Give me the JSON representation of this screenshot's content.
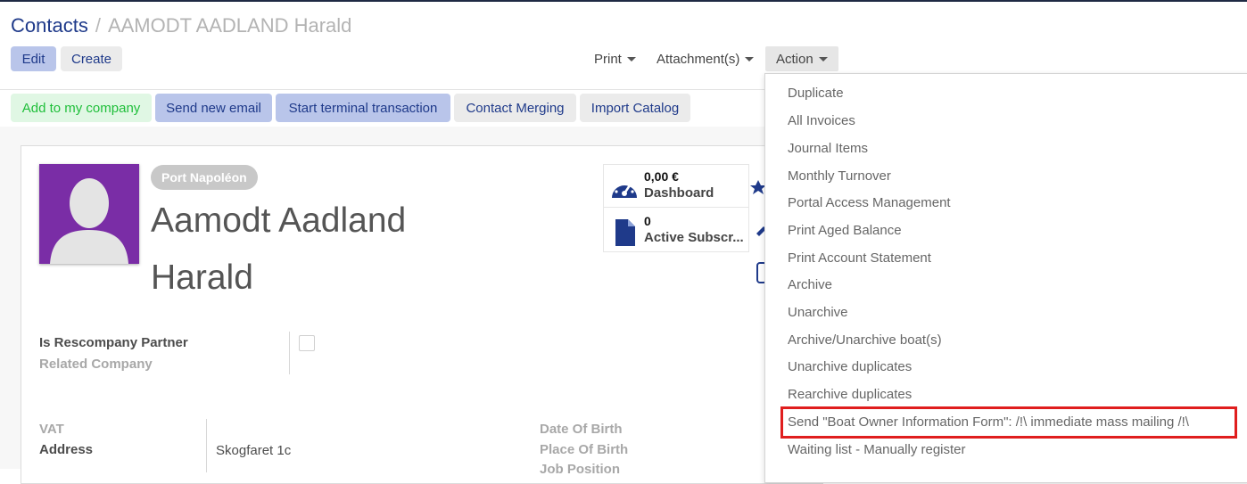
{
  "breadcrumb": {
    "parent": "Contacts",
    "separator": "/",
    "current": "AAMODT AADLAND Harald"
  },
  "buttons": {
    "edit": "Edit",
    "create": "Create"
  },
  "toolbar": {
    "print": "Print",
    "attachments": "Attachment(s)",
    "action": "Action"
  },
  "statusbar": {
    "add_company": "Add to my company",
    "send_email": "Send new email",
    "start_terminal": "Start terminal transaction",
    "contact_merging": "Contact Merging",
    "import_catalog": "Import Catalog"
  },
  "partner": {
    "tag": "Port Napoléon",
    "name_line1": "Aamodt Aadland",
    "name_line2": "Harald"
  },
  "stats": [
    {
      "value": "0,00 €",
      "label": "Dashboard",
      "icon": "dashboard-gauge-icon"
    },
    {
      "value": "0",
      "label": "Active Subscr...",
      "icon": "document-icon"
    }
  ],
  "fields": {
    "is_rescompany_partner": "Is Rescompany Partner",
    "related_company": "Related Company",
    "vat": "VAT",
    "address": "Address",
    "address_value": "Skogfaret 1c",
    "date_of_birth": "Date Of Birth",
    "place_of_birth": "Place Of Birth",
    "job_position": "Job Position"
  },
  "action_menu": {
    "items": [
      "Duplicate",
      "All Invoices",
      "Journal Items",
      "Monthly Turnover",
      "Portal Access Management",
      "Print Aged Balance",
      "Print Account Statement",
      "Archive",
      "Unarchive",
      "Archive/Unarchive boat(s)",
      "Unarchive duplicates",
      "Rearchive duplicates",
      "Send \"Boat Owner Information Form\": /!\\ immediate mass mailing /!\\",
      "Waiting list - Manually register"
    ],
    "highlighted_index": 12,
    "highlight_color": "#e01e1e"
  },
  "colors": {
    "primary": "#1f3a8a",
    "avatar_bg": "#7a2da6",
    "success": "#1fbf3a"
  }
}
